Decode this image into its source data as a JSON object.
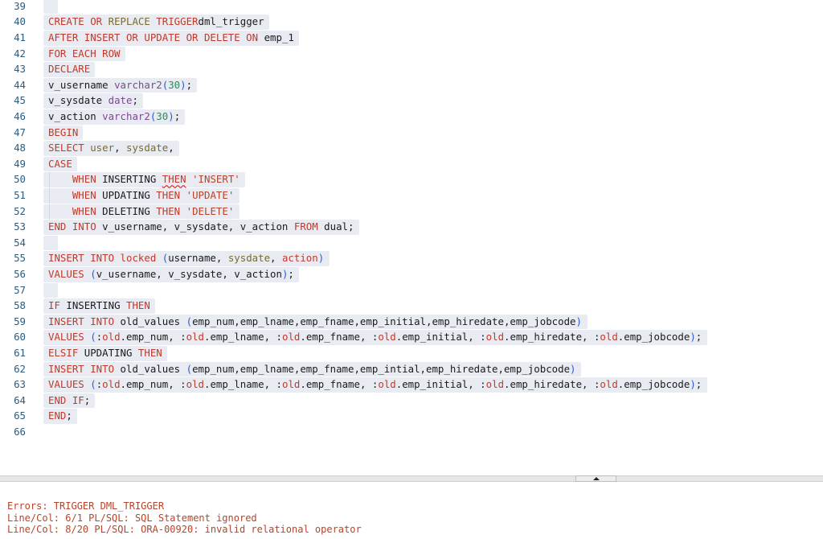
{
  "editor": {
    "lines": [
      {
        "n": "39",
        "tokens": []
      },
      {
        "n": "40",
        "tokens": [
          [
            "kw",
            "CREATE OR "
          ],
          [
            "kw2",
            "REPLACE"
          ],
          [
            "kw",
            " TRIGGER"
          ],
          [
            "",
            "dml_trigger"
          ]
        ]
      },
      {
        "n": "41",
        "tokens": [
          [
            "kw",
            "AFTER INSERT OR UPDATE OR DELETE ON "
          ],
          [
            "",
            "emp_1"
          ]
        ]
      },
      {
        "n": "42",
        "tokens": [
          [
            "kw",
            "FOR EACH ROW"
          ]
        ]
      },
      {
        "n": "43",
        "tokens": [
          [
            "kw",
            "DECLARE"
          ]
        ]
      },
      {
        "n": "44",
        "tokens": [
          [
            "",
            "v_username "
          ],
          [
            "typ",
            "varchar2"
          ],
          [
            "par",
            "("
          ],
          [
            "num",
            "30"
          ],
          [
            "par",
            ")"
          ],
          [
            "",
            ";"
          ]
        ]
      },
      {
        "n": "45",
        "tokens": [
          [
            "",
            "v_sysdate "
          ],
          [
            "typ",
            "date"
          ],
          [
            "",
            ";"
          ]
        ]
      },
      {
        "n": "46",
        "tokens": [
          [
            "",
            "v_action "
          ],
          [
            "typ",
            "varchar2"
          ],
          [
            "par",
            "("
          ],
          [
            "num",
            "30"
          ],
          [
            "par",
            ")"
          ],
          [
            "",
            ";"
          ]
        ]
      },
      {
        "n": "47",
        "tokens": [
          [
            "kw",
            "BEGIN"
          ]
        ]
      },
      {
        "n": "48",
        "tokens": [
          [
            "kw",
            "SELECT "
          ],
          [
            "kw2",
            "user"
          ],
          [
            "",
            ", "
          ],
          [
            "kw2",
            "sysdate"
          ],
          [
            "",
            ","
          ]
        ]
      },
      {
        "n": "49",
        "tokens": [
          [
            "kw",
            "CASE"
          ]
        ]
      },
      {
        "n": "50",
        "tokens": [
          [
            "",
            "    "
          ],
          [
            "kw",
            "WHEN "
          ],
          [
            "",
            "INSERTING "
          ],
          [
            "kw squig",
            "THEN"
          ],
          [
            "",
            " "
          ],
          [
            "str",
            "'INSERT'"
          ]
        ]
      },
      {
        "n": "51",
        "tokens": [
          [
            "",
            "    "
          ],
          [
            "kw",
            "WHEN "
          ],
          [
            "",
            "UPDATING "
          ],
          [
            "kw",
            "THEN "
          ],
          [
            "str",
            "'UPDATE'"
          ]
        ]
      },
      {
        "n": "52",
        "tokens": [
          [
            "",
            "    "
          ],
          [
            "kw",
            "WHEN "
          ],
          [
            "",
            "DELETING "
          ],
          [
            "kw",
            "THEN "
          ],
          [
            "str",
            "'DELETE'"
          ]
        ]
      },
      {
        "n": "53",
        "tokens": [
          [
            "kw",
            "END INTO "
          ],
          [
            "",
            "v_username, v_sysdate, v_action "
          ],
          [
            "kw",
            "FROM "
          ],
          [
            "",
            "dual;"
          ]
        ]
      },
      {
        "n": "54",
        "tokens": []
      },
      {
        "n": "55",
        "tokens": [
          [
            "kw",
            "INSERT INTO "
          ],
          [
            "red",
            "locked "
          ],
          [
            "par",
            "("
          ],
          [
            "",
            "username, "
          ],
          [
            "kw2",
            "sysdate"
          ],
          [
            "",
            ", "
          ],
          [
            "red",
            "action"
          ],
          [
            "par",
            ")"
          ]
        ]
      },
      {
        "n": "56",
        "tokens": [
          [
            "kw",
            "VALUES "
          ],
          [
            "par",
            "("
          ],
          [
            "",
            "v_username, v_sysdate, v_action"
          ],
          [
            "par",
            ")"
          ],
          [
            "",
            ";"
          ]
        ]
      },
      {
        "n": "57",
        "tokens": []
      },
      {
        "n": "58",
        "tokens": [
          [
            "kw",
            "IF "
          ],
          [
            "",
            "INSERTING "
          ],
          [
            "kw",
            "THEN"
          ]
        ]
      },
      {
        "n": "59",
        "tokens": [
          [
            "kw",
            "INSERT INTO "
          ],
          [
            "",
            "old_values "
          ],
          [
            "par",
            "("
          ],
          [
            "",
            "emp_num,emp_lname,emp_fname,emp_initial,emp_hiredate,emp_jobcode"
          ],
          [
            "par",
            ")"
          ]
        ]
      },
      {
        "n": "60",
        "tokens": [
          [
            "kw",
            "VALUES "
          ],
          [
            "par",
            "("
          ],
          [
            "",
            ":"
          ],
          [
            "red",
            "old"
          ],
          [
            "",
            ".emp_num, :"
          ],
          [
            "red",
            "old"
          ],
          [
            "",
            ".emp_lname, :"
          ],
          [
            "red",
            "old"
          ],
          [
            "",
            ".emp_fname, :"
          ],
          [
            "red",
            "old"
          ],
          [
            "",
            ".emp_initial, :"
          ],
          [
            "red",
            "old"
          ],
          [
            "",
            ".emp_hiredate, :"
          ],
          [
            "red",
            "old"
          ],
          [
            "",
            ".emp_jobcode"
          ],
          [
            "par",
            ")"
          ],
          [
            "",
            ";"
          ]
        ]
      },
      {
        "n": "61",
        "tokens": [
          [
            "kw",
            "ELSIF "
          ],
          [
            "",
            "UPDATING "
          ],
          [
            "kw",
            "THEN"
          ]
        ]
      },
      {
        "n": "62",
        "tokens": [
          [
            "kw",
            "INSERT INTO "
          ],
          [
            "",
            "old_values "
          ],
          [
            "par",
            "("
          ],
          [
            "",
            "emp_num,emp_lname,emp_fname,emp_intial,emp_hiredate,emp_jobcode"
          ],
          [
            "par",
            ")"
          ]
        ]
      },
      {
        "n": "63",
        "tokens": [
          [
            "kw",
            "VALUES "
          ],
          [
            "par",
            "("
          ],
          [
            "",
            ":"
          ],
          [
            "red",
            "old"
          ],
          [
            "",
            ".emp_num, :"
          ],
          [
            "red",
            "old"
          ],
          [
            "",
            ".emp_lname, :"
          ],
          [
            "red",
            "old"
          ],
          [
            "",
            ".emp_fname, :"
          ],
          [
            "red",
            "old"
          ],
          [
            "",
            ".emp_initial, :"
          ],
          [
            "red",
            "old"
          ],
          [
            "",
            ".emp_hiredate, :"
          ],
          [
            "red",
            "old"
          ],
          [
            "",
            ".emp_jobcode"
          ],
          [
            "par",
            ")"
          ],
          [
            "",
            ";"
          ]
        ]
      },
      {
        "n": "64",
        "tokens": [
          [
            "kw",
            "END IF"
          ],
          [
            "",
            ";"
          ]
        ]
      },
      {
        "n": "65",
        "tokens": [
          [
            "kw",
            "END"
          ],
          [
            "",
            ";"
          ]
        ]
      },
      {
        "n": "66",
        "tokens": []
      }
    ]
  },
  "splitter": {
    "handle_icon": "triangle-up-icon"
  },
  "output": {
    "errors": [
      "Errors: TRIGGER DML_TRIGGER",
      "Line/Col: 6/1 PL/SQL: SQL Statement ignored",
      "Line/Col: 8/20 PL/SQL: ORA-00920: invalid relational operator"
    ]
  }
}
